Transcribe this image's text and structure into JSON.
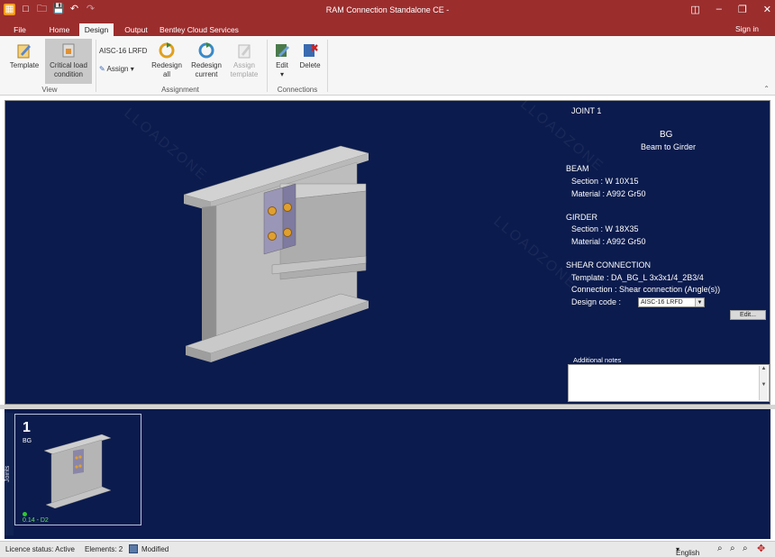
{
  "window": {
    "title": "RAM Connection Standalone CE -"
  },
  "tabs": [
    {
      "label": "File"
    },
    {
      "label": "Home"
    },
    {
      "label": "Design"
    },
    {
      "label": "Output"
    },
    {
      "label": "Bentley Cloud Services"
    }
  ],
  "signin": "Sign in",
  "ribbon": {
    "template": "Template",
    "critical_load": [
      "Critical load",
      "condition"
    ],
    "view_group": "View",
    "design_code": "AISC-16 LRFD",
    "assign": "Assign",
    "redesign_all": [
      "Redesign",
      "all"
    ],
    "redesign_current": [
      "Redesign",
      "current"
    ],
    "assign_template": [
      "Assign",
      "template"
    ],
    "assignment_group": "Assignment",
    "edit": "Edit",
    "delete": "Delete",
    "connections_group": "Connections"
  },
  "panel": {
    "joint": "JOINT 1",
    "code": "BG",
    "desc": "Beam to Girder",
    "beam_h": "BEAM",
    "beam_section": "Section : W 10X15",
    "beam_material": "Material : A992 Gr50",
    "girder_h": "GIRDER",
    "girder_section": "Section : W 18X35",
    "girder_material": "Material : A992 Gr50",
    "shear_h": "SHEAR CONNECTION",
    "shear_template": "Template : DA_BG_L 3x3x1/4_2B3/4",
    "shear_connection": "Connection : Shear connection (Angle(s))",
    "design_code_label": "Design code :",
    "design_code_value": "AISC-16 LRFD",
    "edit_btn": "Edit...",
    "notes_label": "Additional notes"
  },
  "joints_panel": {
    "label": "Joints",
    "thumb_number": "1",
    "thumb_code": "BG",
    "thumb_ratio": "0.14 - D2"
  },
  "statusbar": {
    "licence": "Licence status: Active",
    "elements": "Elements: 2",
    "modified": "Modified",
    "language": "English"
  },
  "watermark": "LLOADZONE",
  "colors": {
    "title_bar": "#9b2d2d",
    "viewport": "#0b1b4d",
    "steel": "#b8b8b8",
    "bolt": "#e0a030"
  }
}
